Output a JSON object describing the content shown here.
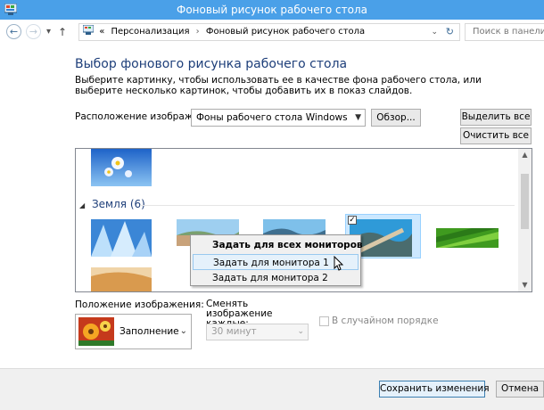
{
  "window": {
    "title": "Фоновый рисунок рабочего стола",
    "icon": "control-panel-icon"
  },
  "nav": {
    "back": "back-arrow-icon",
    "forward": "forward-arrow-icon",
    "recent": "▾",
    "up": "↑",
    "breadcrumb_prefix": "«",
    "breadcrumb": [
      "Персонализация",
      "Фоновый рисунок рабочего стола"
    ],
    "separator": "›",
    "dropdown": "⌄",
    "refresh": "↻",
    "search_placeholder": "Поиск в панели уп"
  },
  "heading": "Выбор фонового рисунка рабочего стола",
  "description": "Выберите картинку, чтобы использовать ее в качестве фона рабочего стола, или выберите несколько картинок, чтобы добавить их в показ слайдов.",
  "location": {
    "label": "Расположение изображения:",
    "value": "Фоны рабочего стола Windows",
    "browse": "Обзор..."
  },
  "buttons": {
    "select_all": "Выделить все",
    "clear_all": "Очистить все",
    "save": "Сохранить изменения",
    "cancel": "Отмена"
  },
  "group": {
    "name": "Земля (6)",
    "toggle": "◢"
  },
  "context_menu": {
    "items": [
      "Задать для всех мониторов",
      "Задать для монитора 1",
      "Задать для монитора 2"
    ],
    "highlighted": 1
  },
  "position": {
    "label": "Положение изображения:",
    "value": "Заполнение"
  },
  "interval": {
    "label": "Сменять изображение каждые:",
    "value": "30 минут"
  },
  "shuffle": {
    "label": "В случайном порядке",
    "checked": false,
    "enabled": false
  },
  "colors": {
    "titlebar": "#4aa0e8",
    "heading": "#1e3f7a",
    "selection": "#cce8ff"
  }
}
